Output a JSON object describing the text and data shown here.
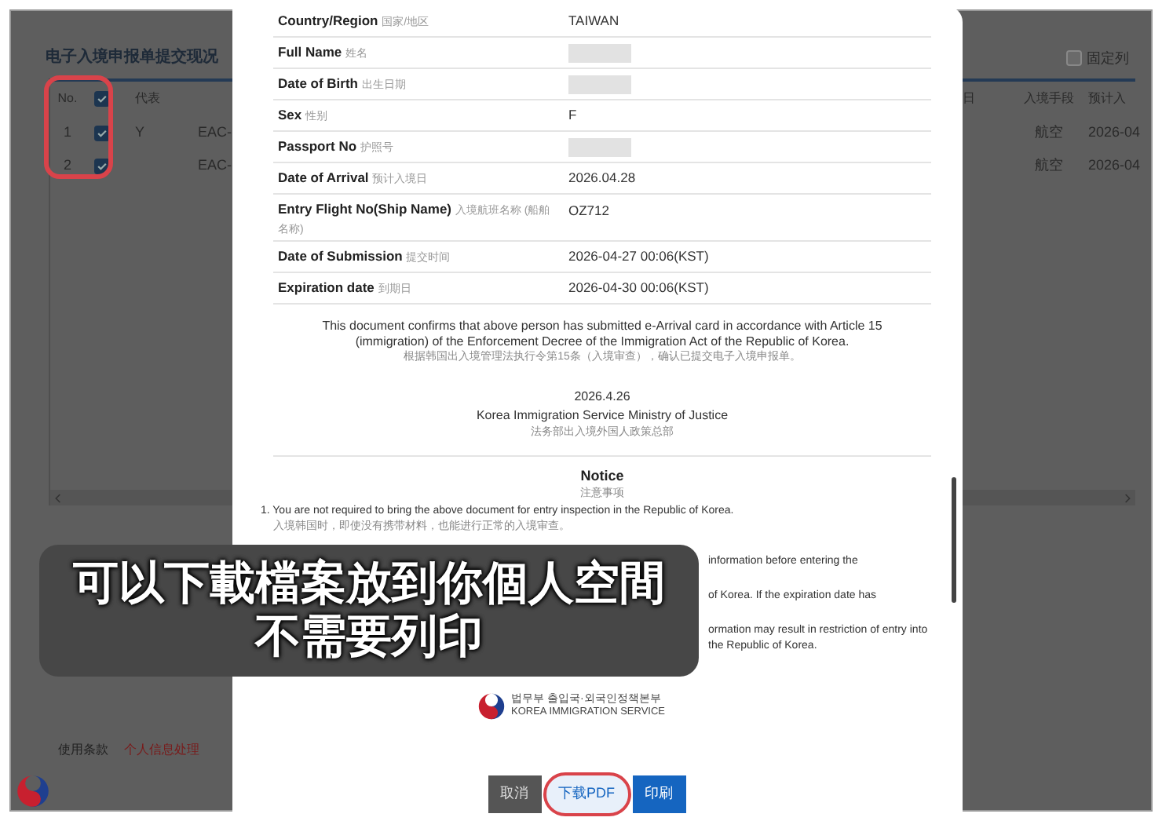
{
  "page": {
    "title": "电子入境申报单提交现况",
    "fixed_column": {
      "label": "固定列",
      "checked": false
    },
    "table": {
      "select_all_checked": true,
      "checkbox_column_circled": true,
      "columns": [
        "No.",
        "代表",
        "日",
        "入境手段",
        "预计入"
      ],
      "rows": [
        {
          "no": "1",
          "checked": true,
          "representative": "Y",
          "column_4": "EAC-",
          "transport": "航空",
          "planned_arrival": "2026-04"
        },
        {
          "no": "2",
          "checked": true,
          "column_4": "EAC-",
          "transport": "航空",
          "planned_arrival": "2026-04"
        }
      ]
    },
    "footer_links": [
      "使用条款",
      "个人信息处理"
    ]
  },
  "modal": {
    "fields": [
      {
        "label": "Country/Region",
        "label_zh": "国家/地区",
        "value": "TAIWAN",
        "redacted": false
      },
      {
        "label": "Full Name",
        "label_zh": "姓名",
        "redacted": true
      },
      {
        "label": "Date of Birth",
        "label_zh": "出生日期",
        "redacted": true
      },
      {
        "label": "Sex",
        "label_zh": "性别",
        "value": "F",
        "redacted": false
      },
      {
        "label": "Passport No",
        "label_zh": "护照号",
        "redacted": true
      },
      {
        "label": "Date of Arrival",
        "label_zh": "预计入境日",
        "value": "2026.04.28",
        "redacted": false
      },
      {
        "label": "Entry Flight No(Ship Name)",
        "label_zh": "入境航班名称 (船舶名称)",
        "value": "OZ712",
        "redacted": false
      },
      {
        "label": "Date of Submission",
        "label_zh": "提交时间",
        "value": "2026-04-27 00:06(KST)",
        "redacted": false
      },
      {
        "label": "Expiration date",
        "label_zh": "到期日",
        "value": "2026-04-30 00:06(KST)",
        "redacted": false
      }
    ],
    "statement": "This document confirms that above person has submitted e-Arrival card in accordance with Article 15 (immigration) of the Enforcement Decree of the Immigration Act of the Republic of Korea.",
    "statement_zh": "根据韩国出入境管理法执行令第15条（入境审查），确认已提交电子入境申报单。",
    "date": "2026.4.26",
    "issuer": "Korea Immigration Service Ministry of Justice",
    "issuer_zh": "法务部出入境外国人政策总部",
    "notice": {
      "title": "Notice",
      "title_zh": "注意事项",
      "items": [
        {
          "text": "1. You are not required to bring the above document for entry inspection in the Republic of Korea.",
          "translation": "入境韩国时，即使没有携带材料，也能进行正常的入境审查。",
          "partial": false
        },
        {
          "text": "information before entering the",
          "partial": true
        },
        {
          "text": "of Korea. If the expiration date has",
          "partial": true
        },
        {
          "text": "ormation may result in restriction of entry into the Republic of Korea.",
          "partial": true
        }
      ]
    },
    "agency": {
      "name_ko": "법무부 출입국·외국인정책본부",
      "name_en": "KOREA IMMIGRATION SERVICE"
    },
    "buttons": [
      {
        "label": "取消",
        "kind": "cancel",
        "circled": false
      },
      {
        "label": "下载PDF",
        "kind": "download",
        "circled": true
      },
      {
        "label": "印刷",
        "kind": "print",
        "circled": false
      }
    ]
  },
  "caption": {
    "lines": [
      "可以下載檔案放到你個人空間",
      "不需要列印"
    ]
  }
}
